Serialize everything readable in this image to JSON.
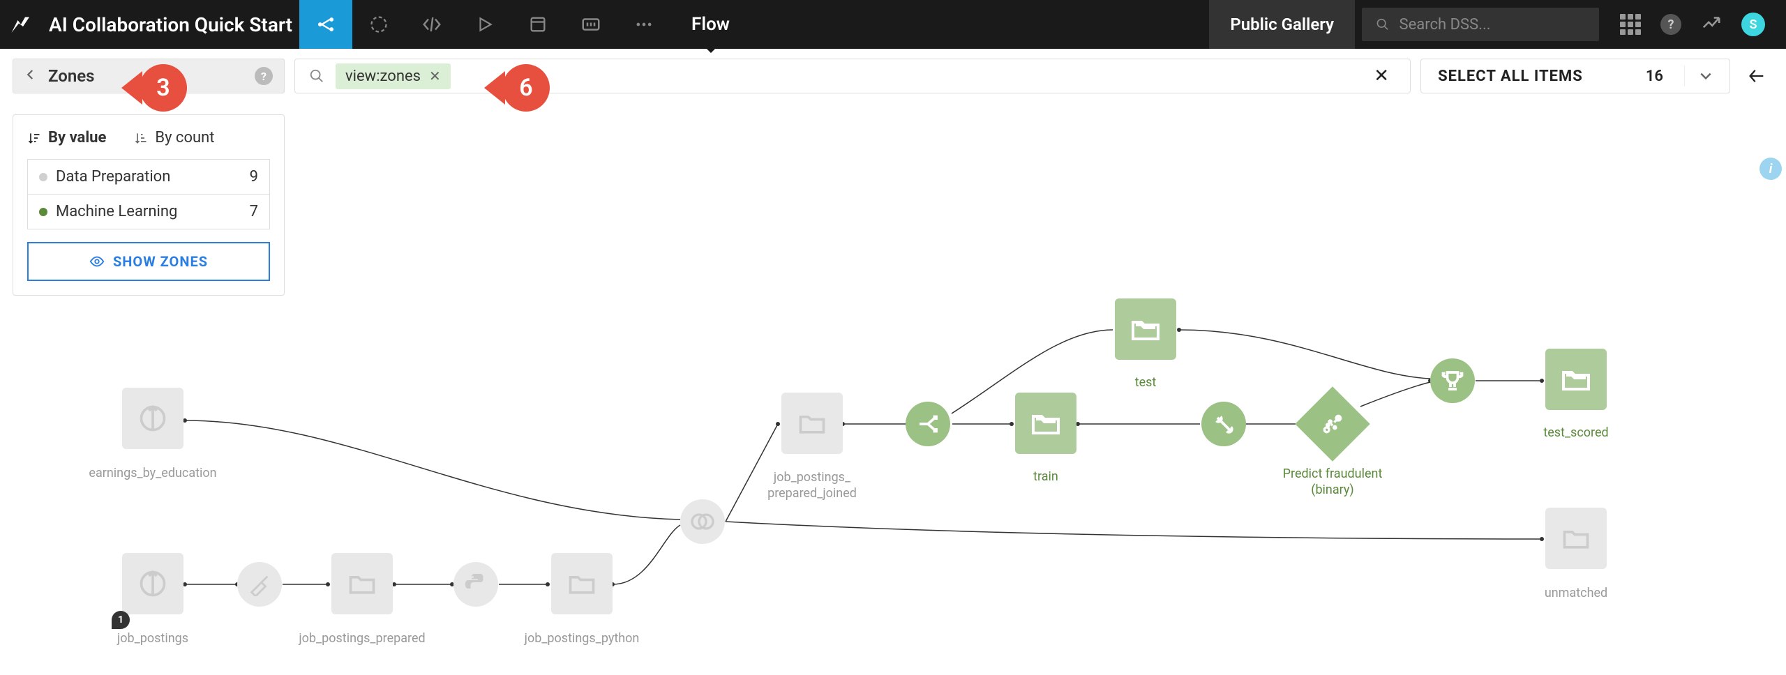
{
  "header": {
    "project_title": "AI Collaboration Quick Start",
    "flow_label": "Flow",
    "public_gallery": "Public Gallery",
    "search_placeholder": "Search DSS...",
    "avatar_initial": "S"
  },
  "zones_bar": {
    "title": "Zones",
    "filter_chip": "view:zones",
    "select_all": "SELECT ALL ITEMS",
    "select_count": "16"
  },
  "annotations": {
    "bubble3": "3",
    "bubble6": "6"
  },
  "panel": {
    "sort_by_value": "By value",
    "sort_by_count": "By count",
    "zones": [
      {
        "name": "Data Preparation",
        "count": "9",
        "color": "#d0d0d0"
      },
      {
        "name": "Machine Learning",
        "count": "7",
        "color": "#5a8a3a"
      }
    ],
    "show_zones": "SHOW ZONES"
  },
  "nodes": {
    "earnings_by_education": "earnings_by_education",
    "job_postings": "job_postings",
    "job_postings_prepared": "job_postings_prepared",
    "job_postings_python": "job_postings_python",
    "job_postings_prepared_joined": "job_postings_\nprepared_joined",
    "train": "train",
    "test": "test",
    "predict": "Predict fraudulent\n(binary)",
    "test_scored": "test_scored",
    "unmatched": "unmatched",
    "comment_count": "1"
  }
}
